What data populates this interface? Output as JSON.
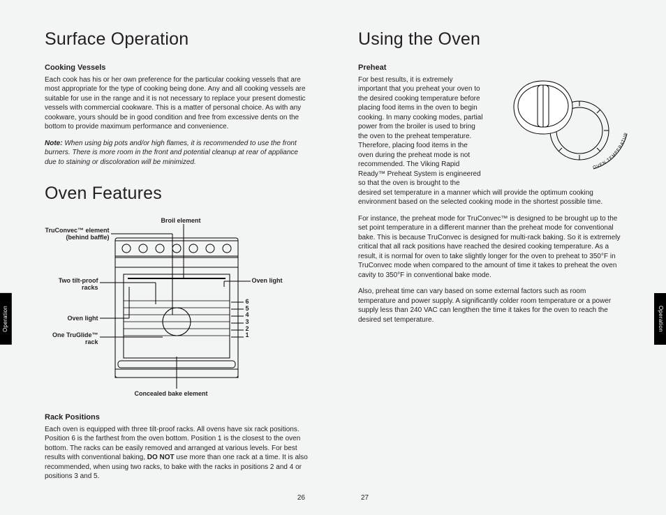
{
  "tabs": {
    "left": "Operation",
    "right": "Operation"
  },
  "pagenum": {
    "left": "26",
    "right": "27"
  },
  "left": {
    "title1": "Surface Operation",
    "vessels_h": "Cooking Vessels",
    "vessels_p": "Each cook has his or her own preference for the particular cooking vessels that are most appropriate for the type of cooking being done. Any and all cooking vessels are suitable for use in the range and it is not necessary to replace your present domestic vessels with commercial cookware. This is a matter of personal choice. As with any cookware, yours should be in good condition and free from excessive dents on the bottom to provide maximum performance and convenience.",
    "note_label": "Note:",
    "note_body": " When using big pots and/or high flames, it is recommended to use the front burners. There is more room in the front and potential cleanup at rear of appliance due to staining or discoloration will be minimized.",
    "title2": "Oven Features",
    "diagram": {
      "broil": "Broil element",
      "truconvec_l1": "TruConvec™ element",
      "truconvec_l2": "(behind baffle)",
      "tiltproof_l1": "Two tilt-proof",
      "tiltproof_l2": "racks",
      "ovenlight": "Oven light",
      "truglide_l1": "One TruGlide™",
      "truglide_l2": "rack",
      "concealed": "Concealed bake element",
      "racknums": [
        "6",
        "5",
        "4",
        "3",
        "2",
        "1"
      ]
    },
    "rack_h": "Rack Positions",
    "rack_p1a": "Each oven is equipped with three tilt-proof racks. All ovens have six rack positions. Position 6 is the farthest from the oven bottom. Position 1 is the closest to the oven bottom. The racks can be easily removed and arranged at various levels. For best results with conventional baking, ",
    "rack_bold": "DO NOT",
    "rack_p1b": " use more than one rack at a time. It is also recommended, when using two racks, to bake with the racks in positions 2 and 4 or positions 3 and 5."
  },
  "right": {
    "title": "Using the Oven",
    "preheat_h": "Preheat",
    "p1": "For best results, it is extremely important that you preheat your oven to the desired cooking temperature before placing food items in the oven to begin cooking. In many cooking modes, partial power from the broiler is used to bring the oven to the preheat temperature. Therefore, placing food items in the oven during the preheat mode is not recommended. The Viking Rapid Ready™ Preheat System is engineered so that the oven is brought to the desired set temperature in a manner which will provide the optimum cooking environment based on the selected cooking mode in the shortest possible time.",
    "p2": "For instance, the preheat mode for TruConvec™ is designed to be brought up to the set point temperature in a different manner than the preheat mode for conventional bake. This is because TruConvec is designed for multi-rack baking. So it is extremely critical that all rack positions have reached the desired cooking temperature. As a result, it is normal for oven to take slightly longer for the oven to preheat to 350°F in TruConvec mode when compared to the amount of time it takes to preheat the oven cavity to 350°F in conventional bake mode.",
    "p3": "Also, preheat time can vary based on some external factors such as room temperature and power supply. A significantly colder room temperature or a power supply less than 240 VAC can lengthen the time it takes for the oven to reach the desired set temperature.",
    "knob_label": "OVEN TEMPERATURE"
  }
}
